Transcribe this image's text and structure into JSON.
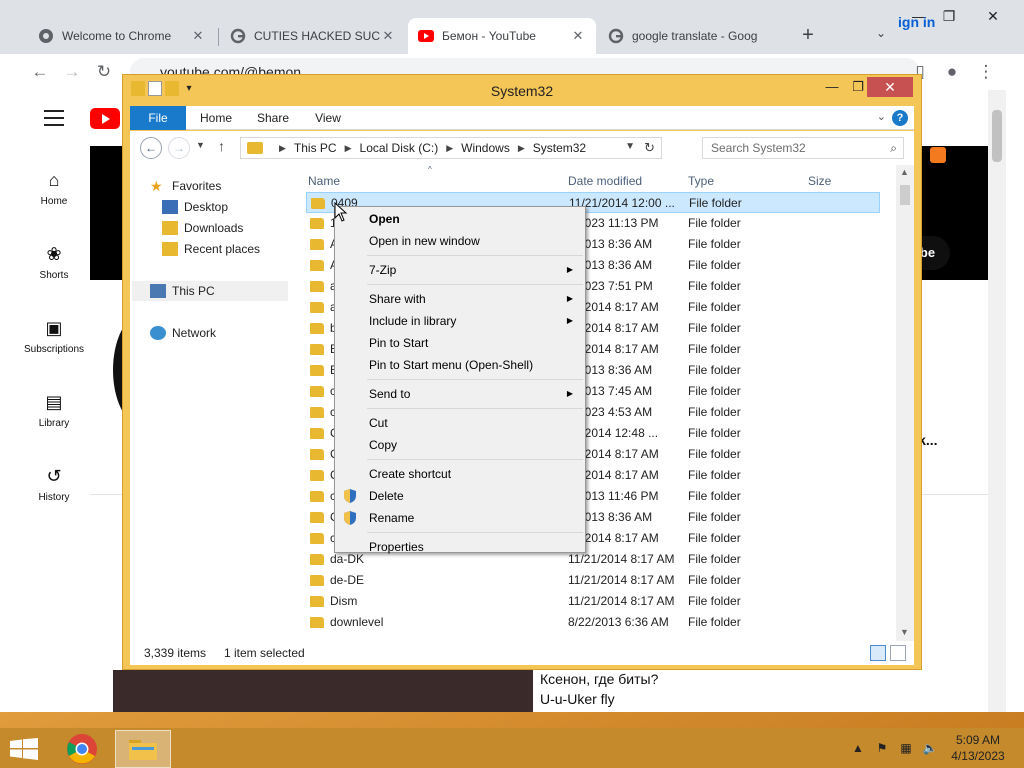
{
  "chrome": {
    "tabs": [
      {
        "title": "Welcome to Chrome",
        "favicon": "chrome-icon"
      },
      {
        "title": "CUTIES HACKED SUCKS",
        "favicon": "google-icon"
      },
      {
        "title": "Бемон - YouTube",
        "favicon": "youtube-icon"
      },
      {
        "title": "google translate - Goog",
        "favicon": "google-icon"
      }
    ],
    "new_tab": "+",
    "tab_menu": "⌄",
    "url": "youtube.com/@bemon"
  },
  "youtube": {
    "nav": [
      {
        "label": "Home",
        "icon": "home-icon"
      },
      {
        "label": "Shorts",
        "icon": "shorts-icon"
      },
      {
        "label": "Subscriptions",
        "icon": "subscriptions-icon"
      },
      {
        "label": "Library",
        "icon": "library-icon"
      },
      {
        "label": "History",
        "icon": "history-icon"
      }
    ],
    "sign_in": "ign in",
    "banner_text": "K",
    "subscribe": "cribe",
    "uk_text": "Uk...",
    "captions": [
      "Ксенон, где биты?",
      "U-u-Uker fly"
    ]
  },
  "explorer": {
    "title": "System32",
    "ribbon_tabs": [
      "File",
      "Home",
      "Share",
      "View"
    ],
    "breadcrumb": [
      "This PC",
      "Local Disk (C:)",
      "Windows",
      "System32"
    ],
    "search_placeholder": "Search System32",
    "nav_tree": [
      {
        "label": "Favorites",
        "icon": "star-icon"
      },
      {
        "label": "Desktop",
        "icon": "desktop-icon"
      },
      {
        "label": "Downloads",
        "icon": "downloads-icon"
      },
      {
        "label": "Recent places",
        "icon": "recent-places-icon"
      },
      {
        "label": "This PC",
        "icon": "computer-icon"
      },
      {
        "label": "Network",
        "icon": "network-icon"
      }
    ],
    "columns": [
      "Name",
      "Date modified",
      "Type",
      "Size"
    ],
    "rows": [
      {
        "name": "0409",
        "date": "11/21/2014 12:00 ...",
        "type": "File folder"
      },
      {
        "name": "1",
        "date": "8/2023 11:13 PM",
        "type": "File folder"
      },
      {
        "name": "A",
        "date": "2/2013 8:36 AM",
        "type": "File folder"
      },
      {
        "name": "A",
        "date": "2/2013 8:36 AM",
        "type": "File folder"
      },
      {
        "name": "a",
        "date": "8/2023 7:51 PM",
        "type": "File folder"
      },
      {
        "name": "a",
        "date": "21/2014 8:17 AM",
        "type": "File folder"
      },
      {
        "name": "b",
        "date": "21/2014 8:17 AM",
        "type": "File folder"
      },
      {
        "name": "B",
        "date": "21/2014 8:17 AM",
        "type": "File folder"
      },
      {
        "name": "B",
        "date": "2/2013 8:36 AM",
        "type": "File folder"
      },
      {
        "name": "c",
        "date": "2/2013 7:45 AM",
        "type": "File folder"
      },
      {
        "name": "c",
        "date": "8/2023 4:53 AM",
        "type": "File folder"
      },
      {
        "name": "C",
        "date": "21/2014 12:48 ...",
        "type": "File folder"
      },
      {
        "name": "C",
        "date": "21/2014 8:17 AM",
        "type": "File folder"
      },
      {
        "name": "C",
        "date": "21/2014 8:17 AM",
        "type": "File folder"
      },
      {
        "name": "c",
        "date": "4/2013 11:46 PM",
        "type": "File folder"
      },
      {
        "name": "C",
        "date": "2/2013 8:36 AM",
        "type": "File folder"
      },
      {
        "name": "c",
        "date": "21/2014 8:17 AM",
        "type": "File folder"
      },
      {
        "name": "da-DK",
        "date": "11/21/2014 8:17 AM",
        "type": "File folder"
      },
      {
        "name": "de-DE",
        "date": "11/21/2014 8:17 AM",
        "type": "File folder"
      },
      {
        "name": "Dism",
        "date": "11/21/2014 8:17 AM",
        "type": "File folder"
      },
      {
        "name": "downlevel",
        "date": "8/22/2013 6:36 AM",
        "type": "File folder"
      }
    ],
    "status_items": "3,339 items",
    "status_selected": "1 item selected"
  },
  "context_menu": [
    {
      "label": "Open",
      "bold": true
    },
    {
      "label": "Open in new window"
    },
    {
      "label": "7-Zip",
      "submenu": true
    },
    {
      "label": "Share with",
      "submenu": true
    },
    {
      "label": "Include in library",
      "submenu": true
    },
    {
      "label": "Pin to Start"
    },
    {
      "label": "Pin to Start menu (Open-Shell)"
    },
    {
      "label": "Send to",
      "submenu": true
    },
    {
      "label": "Cut"
    },
    {
      "label": "Copy"
    },
    {
      "label": "Create shortcut"
    },
    {
      "label": "Delete",
      "shield": true
    },
    {
      "label": "Rename",
      "shield": true
    },
    {
      "label": "Properties"
    }
  ],
  "taskbar": {
    "time": "5:09 AM",
    "date": "4/13/2023"
  },
  "colors": {
    "accent": "#1979ca",
    "selection": "#cce8ff",
    "folder": "#e8b830",
    "window_frame": "#f4c557",
    "close": "#c75050"
  }
}
